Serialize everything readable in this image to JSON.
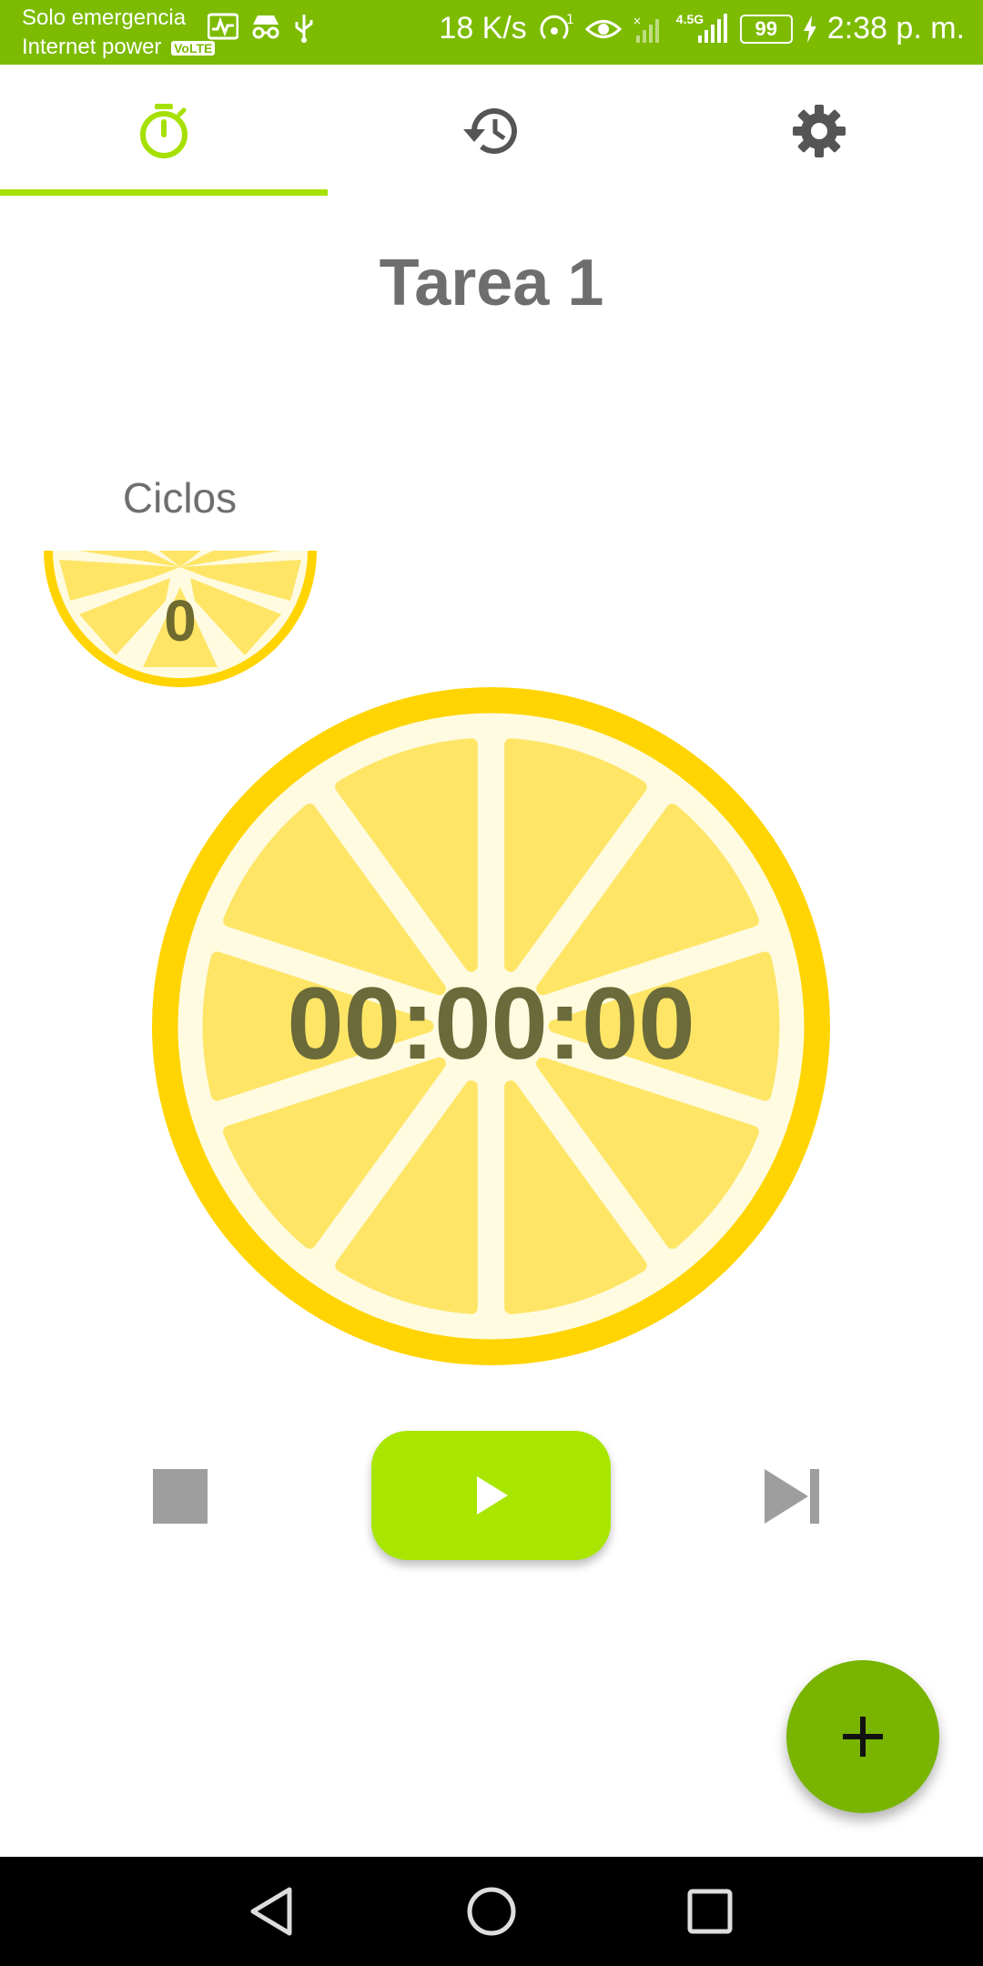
{
  "status_bar": {
    "carrier_line1": "Solo emergencia",
    "carrier_line2": "Internet power",
    "volte": "VoLTE",
    "speed": "18 K/s",
    "network_type": "4.5G",
    "battery": "99",
    "time": "2:38 p. m."
  },
  "tabs": [
    {
      "name": "timer",
      "icon": "stopwatch-icon",
      "active": true
    },
    {
      "name": "history",
      "icon": "history-icon",
      "active": false
    },
    {
      "name": "settings",
      "icon": "gear-icon",
      "active": false
    }
  ],
  "task_title": "Tarea 1",
  "cycles": {
    "label": "Ciclos",
    "count": "0"
  },
  "timer": {
    "display": "00:00:00"
  },
  "controls": {
    "stop": "stop-icon",
    "play": "play-icon",
    "skip": "skip-next-icon"
  },
  "fab": {
    "icon": "plus-icon"
  },
  "colors": {
    "status_bar": "#7cbb00",
    "accent": "#a6e000",
    "lemon_rind": "#ffd400",
    "lemon_pith": "#fffbe0",
    "lemon_segment": "#ffe566",
    "fab": "#78b400",
    "text_gray": "#6e6e6e"
  }
}
